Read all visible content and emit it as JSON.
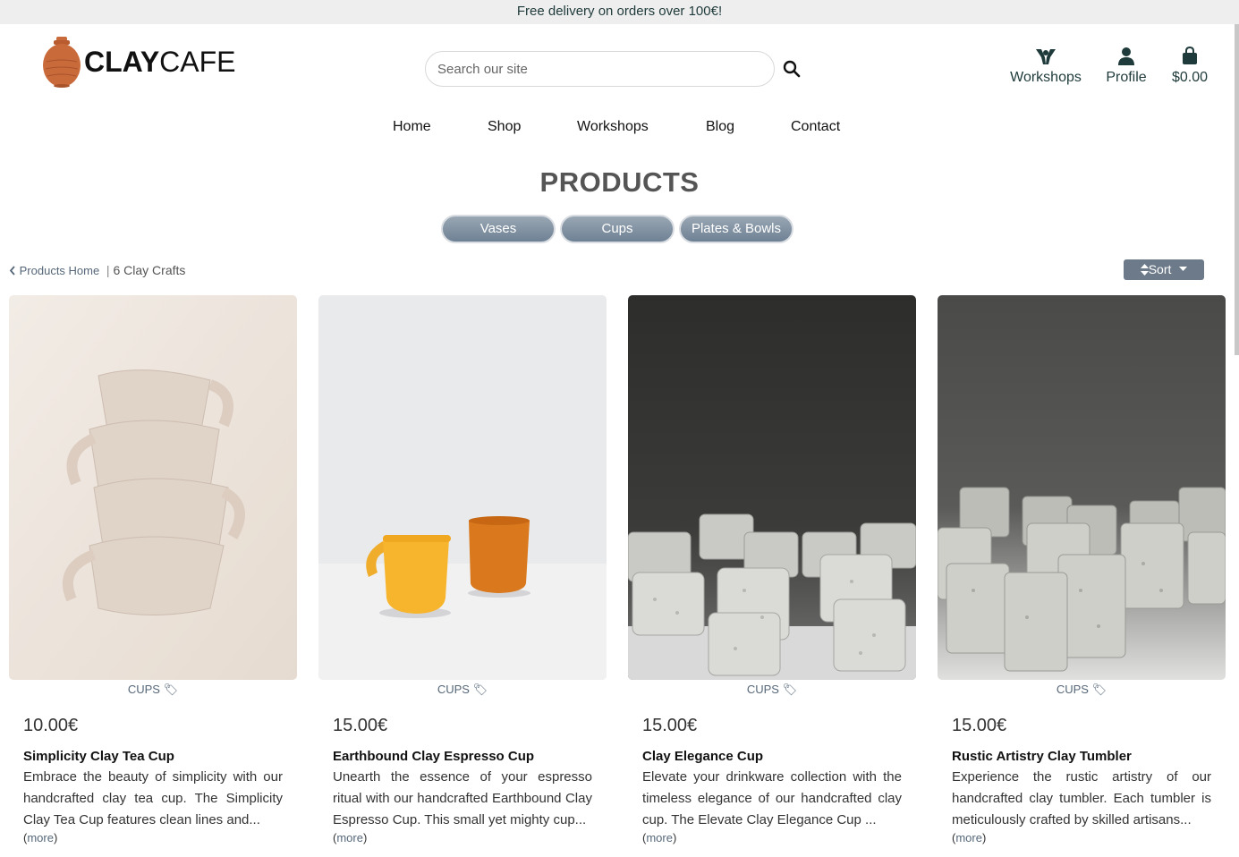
{
  "banner": {
    "text": "Free delivery on orders over 100€!"
  },
  "logo": {
    "part1": "CLAY",
    "part2": "CAFE"
  },
  "search": {
    "placeholder": "Search our site"
  },
  "header_links": {
    "workshops": "Workshops",
    "profile": "Profile",
    "bag_total": "$0.00"
  },
  "nav": {
    "items": [
      "Home",
      "Shop",
      "Workshops",
      "Blog",
      "Contact"
    ]
  },
  "page_title": "PRODUCTS",
  "categories": [
    "Vases",
    "Cups",
    "Plates & Bowls"
  ],
  "breadcrumb": {
    "home": "Products Home",
    "separator": "|",
    "count": "6 Clay Crafts"
  },
  "sort": {
    "label": "Sort"
  },
  "colors": {
    "accent": "#6e8194",
    "brand_orange": "#c96a3b",
    "dark_teal": "#1f3a3a"
  },
  "products": [
    {
      "category": "CUPS",
      "price": "10.00€",
      "name": "Simplicity Clay Tea Cup",
      "description": "Embrace the beauty of simplicity with our handcrafted clay tea cup. The Simplicity Clay Tea Cup features clean lines and...",
      "more": "more"
    },
    {
      "category": "CUPS",
      "price": "15.00€",
      "name": "Earthbound Clay Espresso Cup",
      "description": "Unearth the essence of your espresso ritual with our handcrafted Earthbound Clay Espresso Cup. This small yet mighty cup...",
      "more": "more"
    },
    {
      "category": "CUPS",
      "price": "15.00€",
      "name": "Clay Elegance Cup",
      "description": "Elevate your drinkware collection with the timeless elegance of our handcrafted clay cup. The Elevate Clay Elegance Cup ...",
      "more": "more"
    },
    {
      "category": "CUPS",
      "price": "15.00€",
      "name": "Rustic Artistry Clay Tumbler",
      "description": "Experience the rustic artistry of our handcrafted clay tumbler. Each tumbler is meticulously crafted by skilled artisans...",
      "more": "more"
    }
  ]
}
